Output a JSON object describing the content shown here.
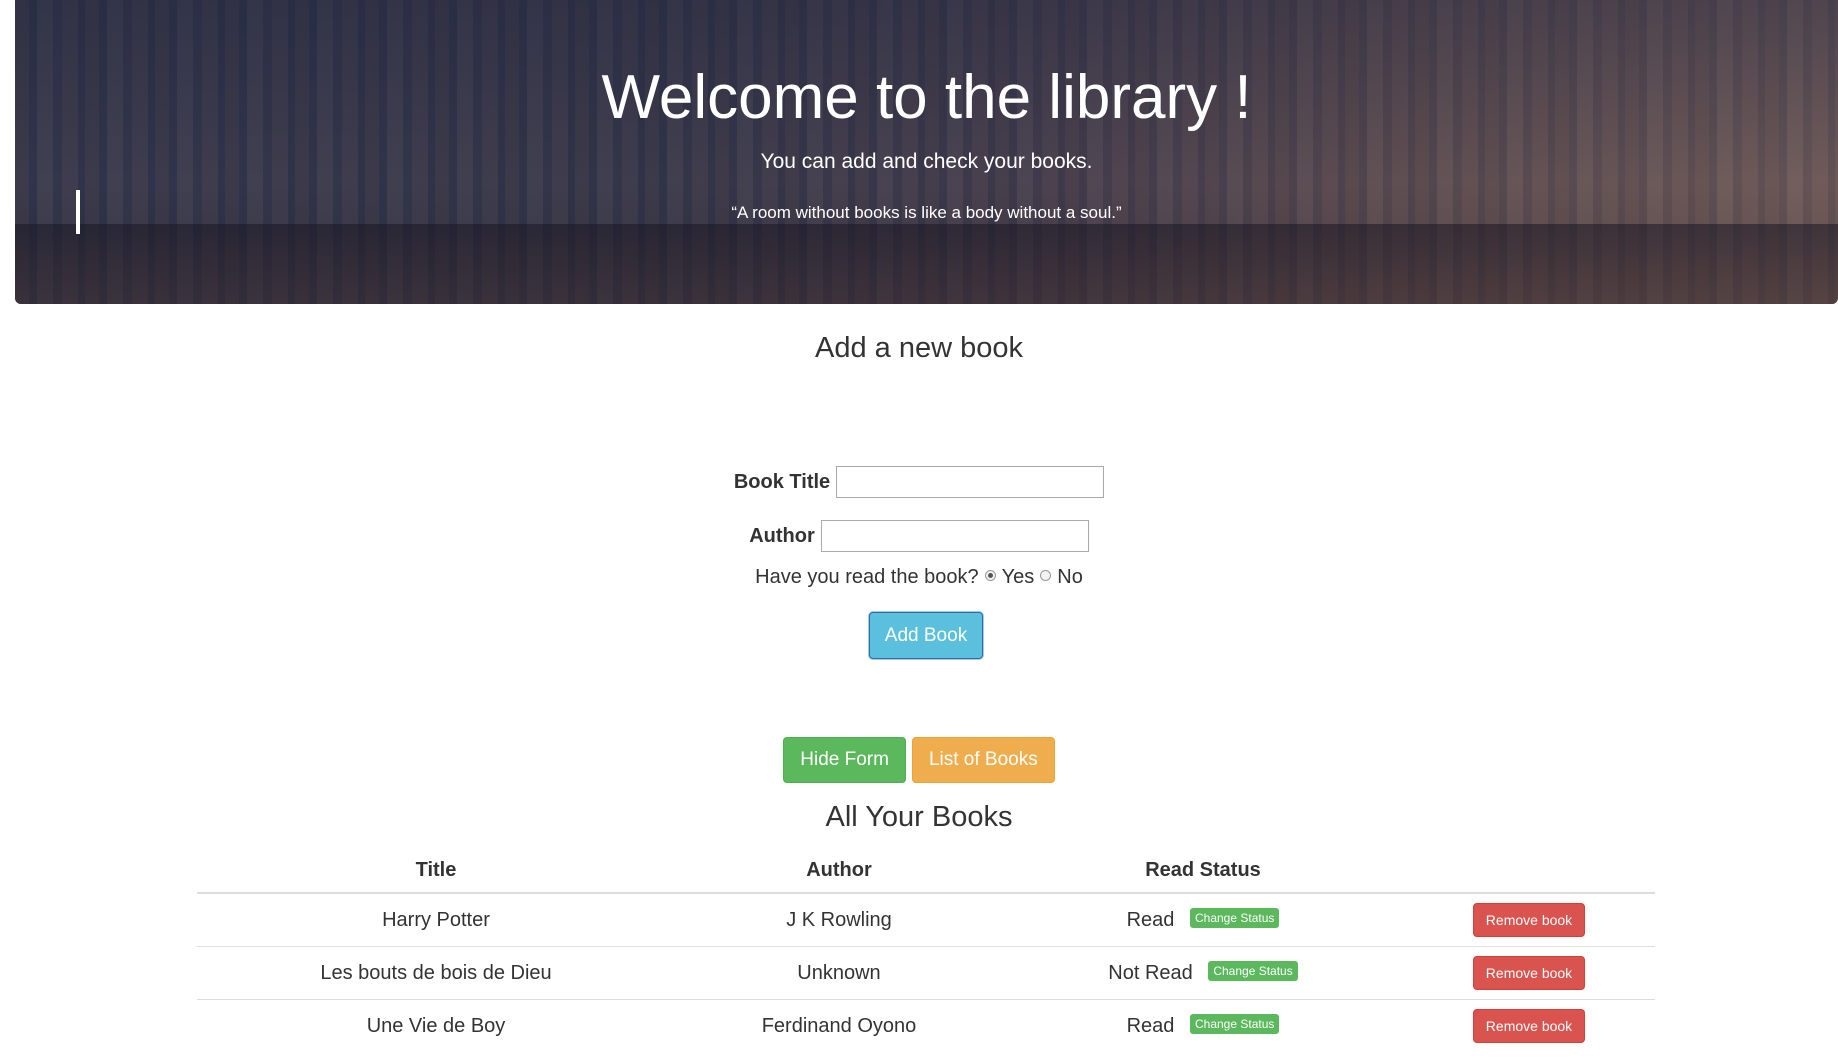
{
  "hero": {
    "title": "Welcome to the library !",
    "subtitle": "You can add and check your books.",
    "quote": "“A room without books is like a body without a soul.”"
  },
  "form": {
    "heading": "Add a new book",
    "title_label": "Book Title",
    "title_value": "",
    "author_label": "Author",
    "author_value": "",
    "read_question": "Have you read the book?",
    "read_options": [
      {
        "label": "Yes",
        "selected": true
      },
      {
        "label": "No",
        "selected": false
      }
    ],
    "submit_label": "Add Book"
  },
  "controls": {
    "hide_form_label": "Hide Form",
    "list_books_label": "List of Books"
  },
  "library": {
    "heading": "All Your Books",
    "columns": [
      "Title",
      "Author",
      "Read Status",
      ""
    ],
    "change_status_label": "Change Status",
    "remove_label": "Remove book",
    "books": [
      {
        "title": "Harry Potter",
        "author": "J K Rowling",
        "status": "Read"
      },
      {
        "title": "Les bouts de bois de Dieu",
        "author": "Unknown",
        "status": "Not Read"
      },
      {
        "title": "Une Vie de Boy",
        "author": "Ferdinand Oyono",
        "status": "Read"
      }
    ]
  },
  "colors": {
    "info": "#5bc0de",
    "success": "#5cb85c",
    "warning": "#f0ad4e",
    "danger": "#d9534f"
  }
}
